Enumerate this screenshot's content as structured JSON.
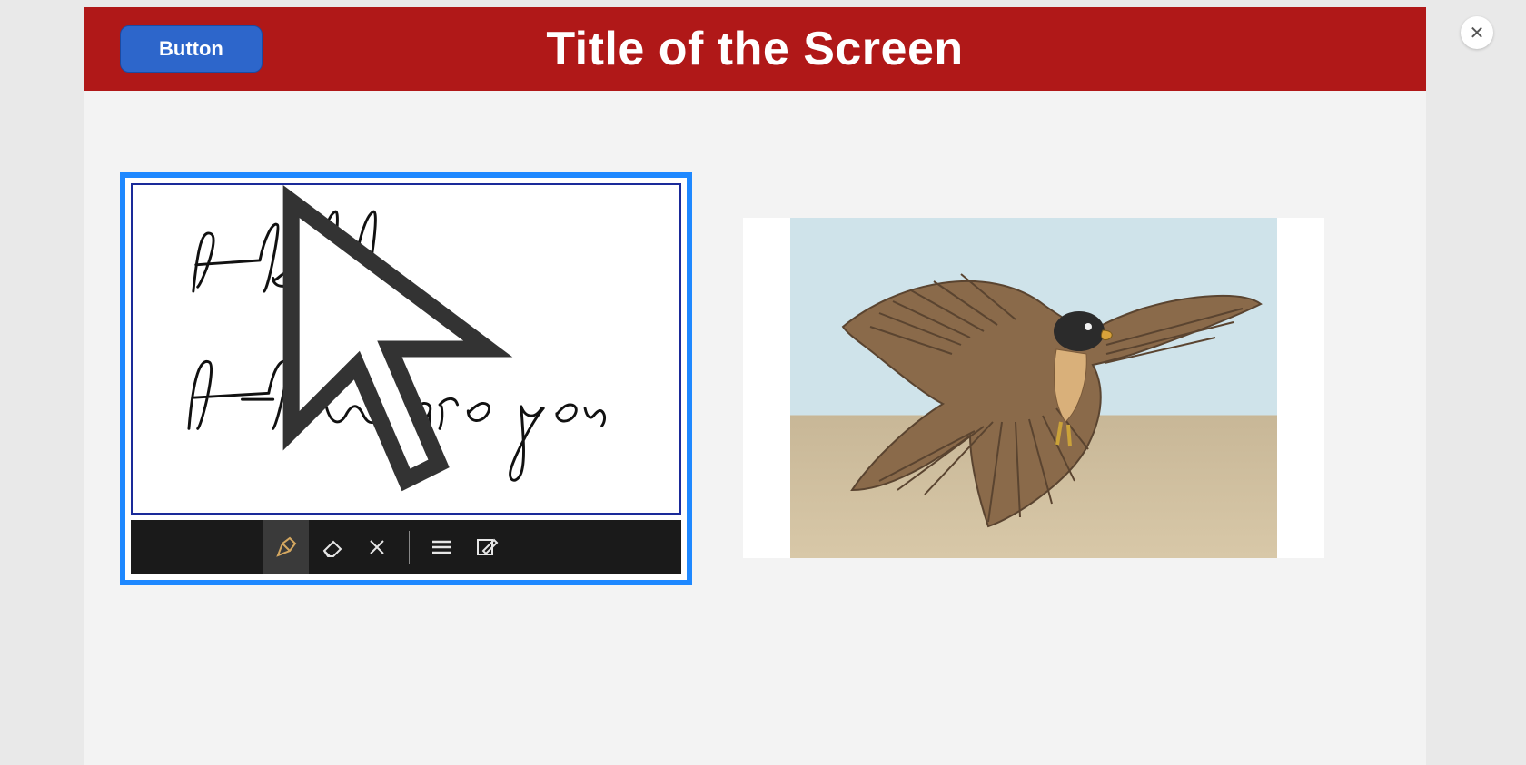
{
  "header": {
    "button_label": "Button",
    "title": "Title of the Screen"
  },
  "signature_pad": {
    "handwritten_text_line1": "Hello,",
    "handwritten_text_line2": "How are you",
    "toolbar": {
      "pen_icon": "pen",
      "eraser_icon": "eraser",
      "clear_icon": "clear",
      "lines_icon": "lines",
      "write_icon": "write",
      "active_tool": "pen"
    }
  },
  "image_panel": {
    "description": "falcon in flight"
  },
  "close_label": "✕"
}
